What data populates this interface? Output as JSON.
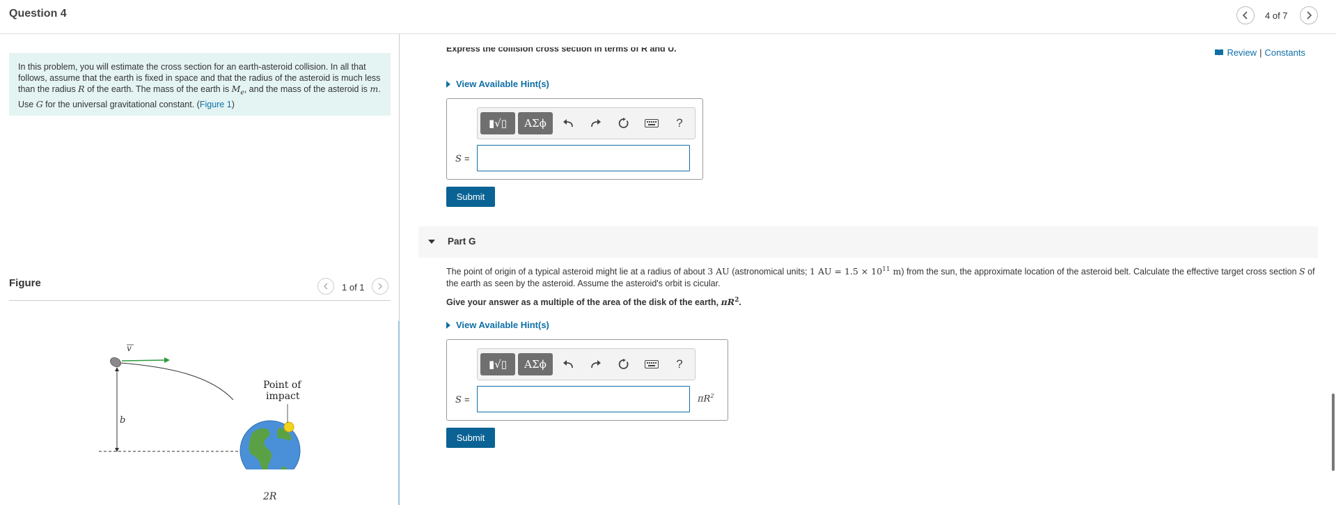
{
  "header": {
    "title": "Question 4",
    "pager": "4 of 7"
  },
  "problem": {
    "intro_1": "In this problem, you will estimate the cross section for an earth-asteroid collision. In all that follows, assume that the earth is fixed in space and that the radius of the asteroid is much less than the radius ",
    "R": "R",
    "intro_2": " of the earth. The mass of the earth is ",
    "Me": "M",
    "Me_sub": "e",
    "intro_3": ", and the mass of the asteroid is ",
    "m": "m",
    "intro_4": ". Use ",
    "G": "G",
    "intro_5": " for the universal gravitational constant. (",
    "figure_link": "Figure 1",
    "intro_6": ")"
  },
  "figure": {
    "title": "Figure",
    "pager": "1 of 1",
    "label_v": "v",
    "label_b": "b",
    "label_impact_1": "Point of",
    "label_impact_2": "impact",
    "label_2R": "2R"
  },
  "links": {
    "review": "Review",
    "separator": "|",
    "constants": "Constants"
  },
  "part_f": {
    "cut_text": "Express the collision cross section in terms of R and U.",
    "hint": "View Available Hint(s)",
    "var_label": "S",
    "eq": "=",
    "submit": "Submit"
  },
  "toolbar": {
    "templates": "▮√▯",
    "greek": "ΑΣϕ",
    "help": "?"
  },
  "part_g": {
    "title": "Part G",
    "text_1": "The point of origin of a typical asteroid might lie at a radius of about ",
    "math_1": "3 AU",
    "text_2": " (astronomical units; ",
    "math_2": "1 AU = 1.5 × 10",
    "math_2_exp": "11",
    "math_2_unit": " m",
    "text_3": ") from the sun, the approximate location of the asteroid belt. Calculate the effective target cross section ",
    "S": "S",
    "text_4": " of the earth as seen by the asteroid.  Assume the asteroid's orbit is cicular.",
    "question_1": "Give your answer as a multiple of the area of the disk of the earth, ",
    "question_math": "πR",
    "question_exp": "2",
    "question_2": ".",
    "hint": "View Available Hint(s)",
    "var_label": "S",
    "eq": "=",
    "units": "πR",
    "units_exp": "2",
    "submit": "Submit"
  },
  "colors": {
    "accent": "#0f6fa6",
    "submit": "#0a6394",
    "intro_bg": "#e4f4f3"
  }
}
